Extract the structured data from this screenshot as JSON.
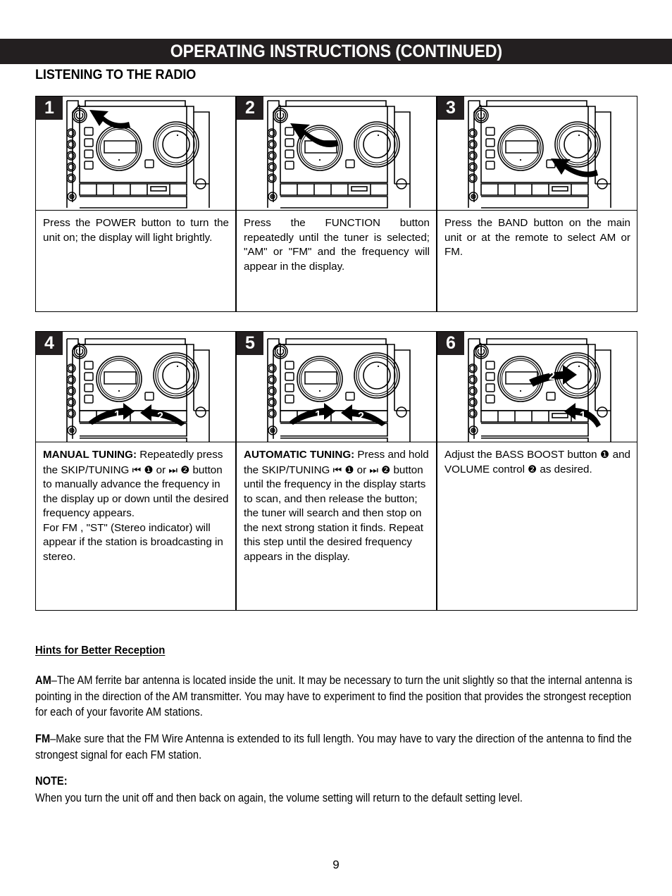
{
  "header": {
    "title": "OPERATING INSTRUCTIONS (CONTINUED)",
    "bar_color": "#231f20"
  },
  "section": {
    "title": "LISTENING TO THE RADIO"
  },
  "steps": [
    {
      "number": "1",
      "text_html": "Press the POWER button to turn the unit on; the display will light brightly.",
      "align": "justify",
      "diagram": {
        "name": "stereo-front-panel-power",
        "arrow_targets": [
          "power-button"
        ],
        "callouts": []
      }
    },
    {
      "number": "2",
      "text_html": "Press the FUNCTION button repeatedly until the tuner is selected; \"AM\" or \"FM\" and the frequency will appear in the display.",
      "align": "justify",
      "diagram": {
        "name": "stereo-front-panel-function",
        "arrow_targets": [
          "function-button"
        ],
        "callouts": []
      }
    },
    {
      "number": "3",
      "text_html": "Press the BAND button on the main unit or at the remote to select AM or FM.",
      "align": "justify",
      "diagram": {
        "name": "stereo-front-panel-band",
        "arrow_targets": [
          "band-button"
        ],
        "callouts": []
      }
    },
    {
      "number": "4",
      "text_html": "<b>MANUAL TUNING:</b> Repeatedly press the SKIP/TUNING <span class=\"sym\">&#9198;</span> <span class=\"cnum\">&#10102;</span> or <span class=\"sym\">&#9197;</span> <span class=\"cnum\">&#10103;</span> button to manually advance the frequency in the display up or down until the desired frequency appears.<br>For FM , \"ST\" (Stereo indicator) will appear if the station is broadcasting in stereo.",
      "align": "left",
      "diagram": {
        "name": "stereo-front-panel-skip-tuning",
        "arrow_targets": [
          "skip-back-button",
          "skip-forward-button"
        ],
        "callouts": [
          "1",
          "2"
        ]
      }
    },
    {
      "number": "5",
      "text_html": "<b>AUTOMATIC TUNING:</b> Press and hold the SKIP/TUNING <span class=\"sym\">&#9198;</span> <span class=\"cnum\">&#10102;</span> or <span class=\"sym\">&#9197;</span> <span class=\"cnum\">&#10103;</span> button until the frequency in the display starts to scan, and then release the button; the tuner will search and then stop on the next strong station it finds. Repeat this step until the desired frequency appears in the display.",
      "align": "left",
      "diagram": {
        "name": "stereo-front-panel-auto-tuning",
        "arrow_targets": [
          "skip-back-button",
          "skip-forward-button"
        ],
        "callouts": [
          "1",
          "2"
        ]
      }
    },
    {
      "number": "6",
      "text_html": "Adjust the BASS BOOST button <span class=\"cnum\">&#10102;</span> and VOLUME control <span class=\"cnum\">&#10103;</span> as desired.",
      "align": "justify",
      "diagram": {
        "name": "stereo-front-panel-bass-volume",
        "arrow_targets": [
          "volume-knob",
          "bass-boost-button"
        ],
        "callouts": [
          "2",
          "1"
        ]
      }
    }
  ],
  "hints": {
    "heading": "Hints for Better Reception",
    "am_label": "AM",
    "am_text": "–The AM ferrite bar antenna is located inside the unit. It may be necessary to turn the unit slightly so that the internal antenna is pointing in the direction of the AM transmitter. You may have to experiment to find the position that provides the strongest reception for each of your favorite AM stations.",
    "fm_label": "FM",
    "fm_text": "–Make sure that the FM Wire Antenna is extended to its full length. You may have to vary the direction of the antenna to find the strongest signal for each FM station.",
    "note_heading": "NOTE:",
    "note_text": "When you turn the unit off and then back on again, the volume setting will return to the default setting level."
  },
  "footer": {
    "page_number": "9"
  },
  "icons": {
    "power": "⏻",
    "skip_back": "⏮",
    "skip_forward": "⏭",
    "circled_one": "❶",
    "circled_two": "❷"
  }
}
